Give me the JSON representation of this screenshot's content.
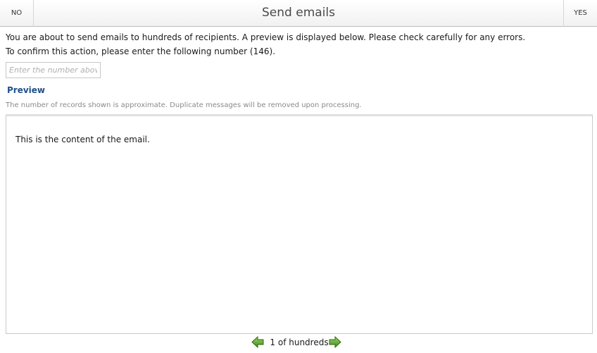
{
  "header": {
    "no_label": "NO",
    "title": "Send emails",
    "yes_label": "YES"
  },
  "message": {
    "line1": "You are about to send emails to hundreds of recipients. A preview is displayed below. Please check carefully for any errors.",
    "line2": "To confirm this action, please enter the following number (146)."
  },
  "confirm_input": {
    "value": "",
    "placeholder": "Enter the number above"
  },
  "preview": {
    "title": "Preview",
    "note": "The number of records shown is approximate. Duplicate messages will be removed upon processing.",
    "content": "This is the content of the email."
  },
  "pager": {
    "label": "1 of hundreds",
    "prev_icon": "arrow-left-icon",
    "next_icon": "arrow-right-icon"
  },
  "colors": {
    "accent": "#1f4e8c",
    "arrow_green": "#5aa02c"
  }
}
